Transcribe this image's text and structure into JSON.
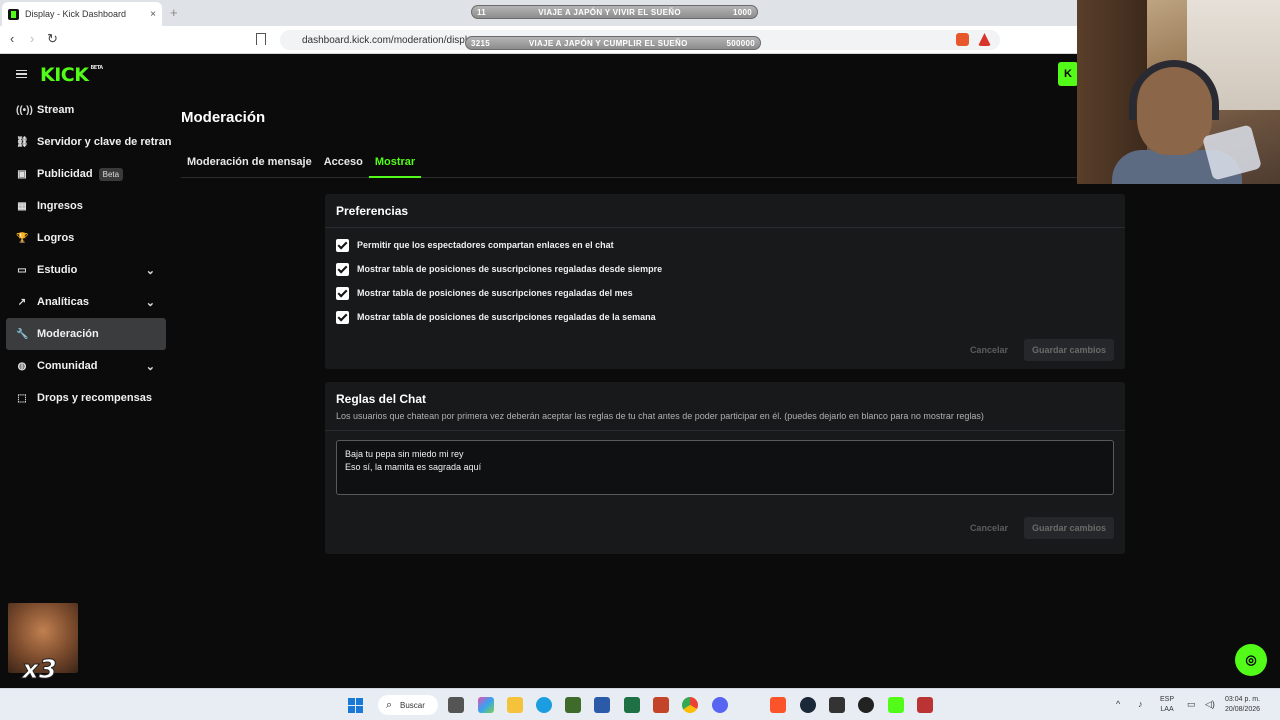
{
  "browser": {
    "tab_title": "Display - Kick Dashboard",
    "tab_close": "×",
    "new_tab": "+",
    "url": "dashboard.kick.com/moderation/display",
    "back": "‹",
    "forward": "›",
    "reload": "↻"
  },
  "overlays": {
    "goal1": {
      "left": "11",
      "label": "VIAJE A JAPÓN Y VIVIR EL SUEÑO",
      "right": "1000"
    },
    "goal2": {
      "left": "3215",
      "label": "VIAJE A JAPÓN Y CUMPLIR EL SUEÑO",
      "right": "500000"
    },
    "emote_text": "x3"
  },
  "header": {
    "logo": "KICK",
    "logo_badge": "BETA",
    "kick_button": "K"
  },
  "sidebar": {
    "items": [
      {
        "label": "Stream",
        "icon": "broadcast-icon",
        "glyph": "((•))"
      },
      {
        "label": "Servidor y clave de retransmisión",
        "icon": "link-icon",
        "glyph": "⛓"
      },
      {
        "label": "Publicidad",
        "icon": "ad-icon",
        "glyph": "▣",
        "badge": "Beta"
      },
      {
        "label": "Ingresos",
        "icon": "revenue-icon",
        "glyph": "▦"
      },
      {
        "label": "Logros",
        "icon": "trophy-icon",
        "glyph": "🏆"
      },
      {
        "label": "Estudio",
        "icon": "studio-icon",
        "glyph": "▭",
        "chevron": "⌄"
      },
      {
        "label": "Analíticas",
        "icon": "analytics-icon",
        "glyph": "↗",
        "chevron": "⌄"
      },
      {
        "label": "Moderación",
        "icon": "wrench-icon",
        "glyph": "🔧"
      },
      {
        "label": "Comunidad",
        "icon": "community-icon",
        "glyph": "◍",
        "chevron": "⌄"
      },
      {
        "label": "Drops y recompensas",
        "icon": "drops-icon",
        "glyph": "⬚"
      }
    ]
  },
  "main": {
    "title": "Moderación",
    "tabs": [
      {
        "label": "Moderación de mensaje"
      },
      {
        "label": "Acceso"
      },
      {
        "label": "Mostrar"
      }
    ],
    "preferences": {
      "title": "Preferencias",
      "options": [
        {
          "label": "Permitir que los espectadores compartan enlaces en el chat",
          "checked": true
        },
        {
          "label": "Mostrar tabla de posiciones de suscripciones regaladas desde siempre",
          "checked": true
        },
        {
          "label": "Mostrar tabla de posiciones de suscripciones regaladas del mes",
          "checked": true
        },
        {
          "label": "Mostrar tabla de posiciones de suscripciones regaladas de la semana",
          "checked": true
        }
      ],
      "cancel": "Cancelar",
      "save": "Guardar cambios"
    },
    "rules": {
      "title": "Reglas del Chat",
      "description": "Los usuarios que chatean por primera vez deberán aceptar las reglas de tu chat antes de poder participar en él. (puedes dejarlo en blanco para no mostrar reglas)",
      "value": "Baja tu pepa sin miedo mi rey\nEso sí, la mamita es sagrada aquí",
      "cancel": "Cancelar",
      "save": "Guardar cambios"
    }
  },
  "support_icon": "◎",
  "taskbar": {
    "search": "Buscar",
    "lang": "ESP",
    "layout": "LAA",
    "time": "03:04 p. m.",
    "date": "20/08/2026"
  },
  "colors": {
    "accent": "#53fc18",
    "background": "#0b0b0c",
    "card": "#18191b"
  }
}
